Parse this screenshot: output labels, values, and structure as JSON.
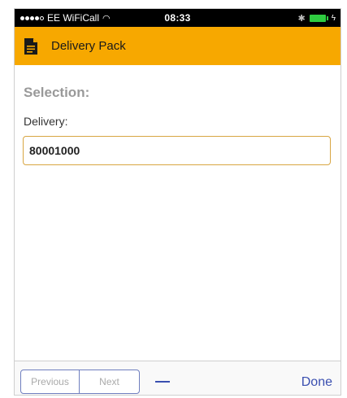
{
  "status_bar": {
    "carrier": "EE WiFiCall",
    "time": "08:33",
    "signal_icon": "signal-dots-icon",
    "wifi_icon": "wifi-icon",
    "bluetooth_icon": "bluetooth-icon",
    "battery_icon": "battery-charging-icon"
  },
  "header": {
    "title": "Delivery Pack",
    "icon": "document-icon",
    "background": "#f7a800"
  },
  "form": {
    "section_label": "Selection:",
    "delivery_label": "Delivery:",
    "delivery_value": "80001000",
    "input_border": "#d8a642"
  },
  "toolbar": {
    "previous_label": "Previous",
    "next_label": "Next",
    "done_label": "Done",
    "accent": "#3a4fb0"
  }
}
